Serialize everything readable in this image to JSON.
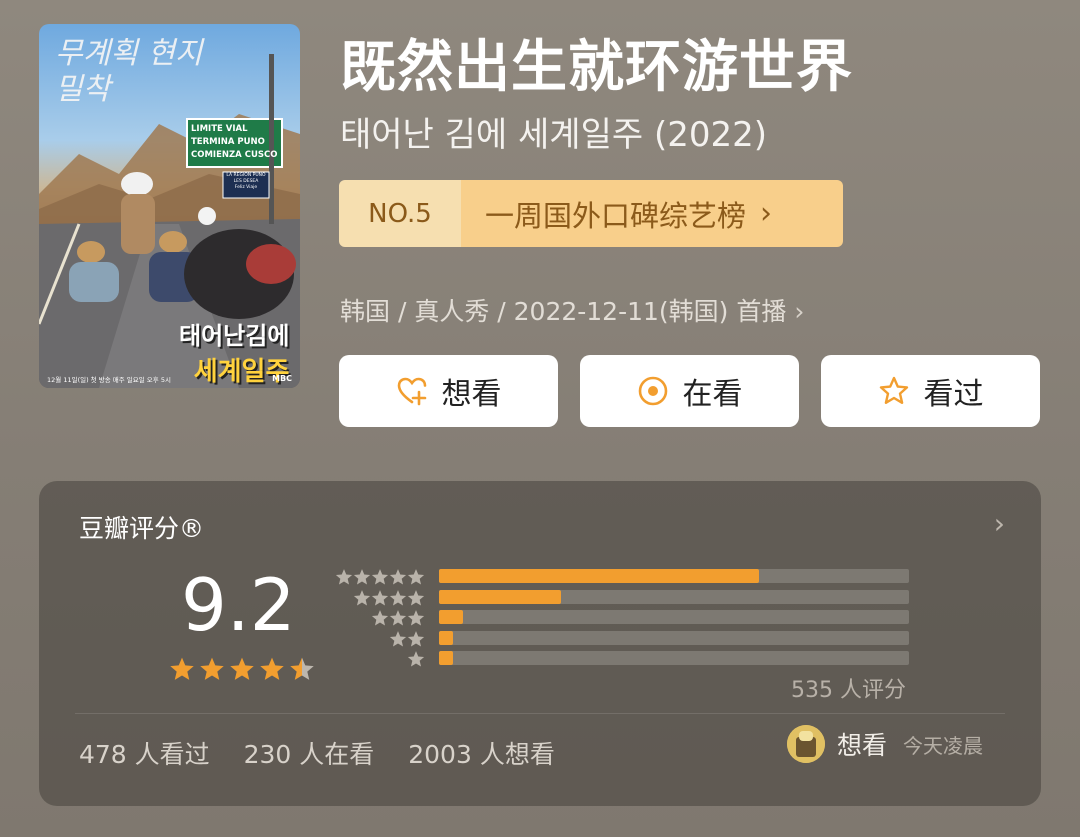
{
  "poster": {
    "handwriting_top": "무계획 현지밀착",
    "sign_lines": [
      "LIMITE  VIAL",
      "TERMINA  PUNO",
      "COMIENZA  CUSCO"
    ],
    "small_sign": "LA REGION PUNO\nLES DESEA\nFeliz Viaje",
    "show_title_line1": "태어난김에",
    "show_title_line2": "세계일주",
    "bottom_caption": "12월 11일(일) 첫 방송  매주 일요일 오후 5시",
    "broadcaster": "MBC"
  },
  "header": {
    "title": "既然出生就环游世界",
    "subtitle": "태어난 김에 세계일주 (2022)"
  },
  "rank": {
    "no": "NO.5",
    "label": "一周国外口碑综艺榜",
    "chevron": "›"
  },
  "meta": {
    "text": "韩国 / 真人秀 / 2022-12-11(韩国) 首播",
    "chevron": "›"
  },
  "actions": [
    {
      "label": "想看",
      "icon": "heart-plus-icon"
    },
    {
      "label": "在看",
      "icon": "target-circle-icon"
    },
    {
      "label": "看过",
      "icon": "star-outline-icon"
    }
  ],
  "rating": {
    "title": "豆瓣评分®",
    "chevron": "›",
    "score": "9.2",
    "stars": 4.5,
    "distribution_percent": [
      68,
      26,
      5,
      1,
      1
    ],
    "count_label": "535 人评分"
  },
  "stats": {
    "watched": "478 人看过",
    "watching": "230 人在看",
    "want": "2003 人想看"
  },
  "friend": {
    "action": "想看",
    "time": "今天凌晨"
  },
  "colors": {
    "accent": "#f29e2f",
    "rank_bg": "#f8cf8b",
    "rank_text": "#8b5a1a"
  }
}
